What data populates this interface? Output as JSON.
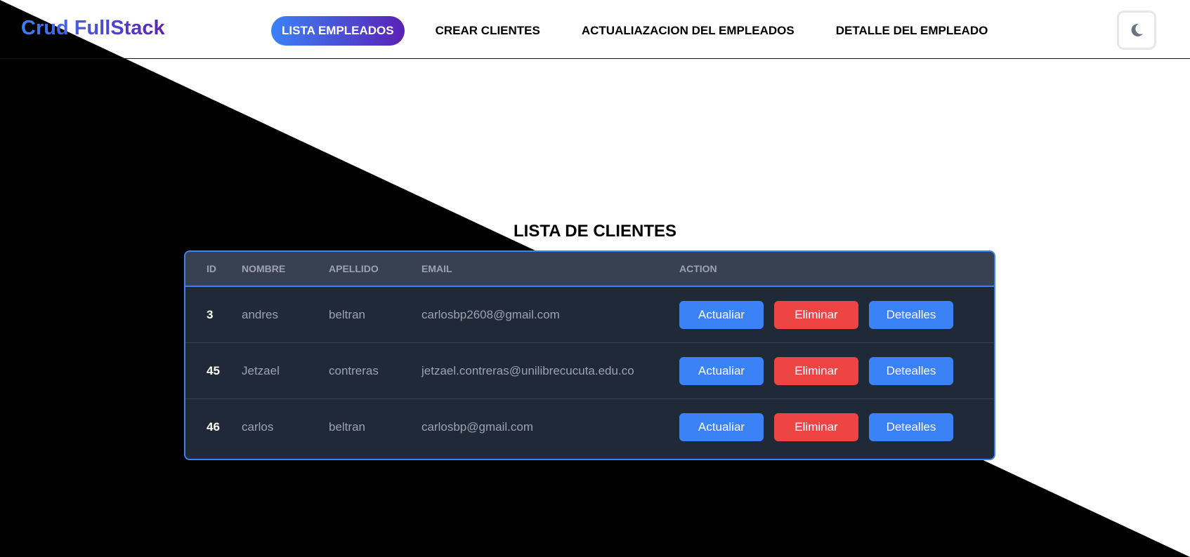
{
  "navbar": {
    "brand": "Crud FullStack",
    "links": [
      {
        "label": "LISTA EMPLEADOS",
        "active": true
      },
      {
        "label": "CREAR CLIENTES",
        "active": false
      },
      {
        "label": "ACTUALIAZACION DEL EMPLEADOS",
        "active": false
      },
      {
        "label": "DETALLE DEL EMPLEADO",
        "active": false
      }
    ],
    "theme_toggle_icon": "moon-icon"
  },
  "main": {
    "title": "LISTA DE CLIENTES",
    "table": {
      "headers": [
        "ID",
        "NOMBRE",
        "APELLIDO",
        "EMAIL",
        "ACTION"
      ],
      "rows": [
        {
          "id": "3",
          "nombre": "andres",
          "apellido": "beltran",
          "email": "carlosbp2608@gmail.com"
        },
        {
          "id": "45",
          "nombre": "Jetzael",
          "apellido": "contreras",
          "email": "jetzael.contreras@unilibrecucuta.edu.co"
        },
        {
          "id": "46",
          "nombre": "carlos",
          "apellido": "beltran",
          "email": "carlosbp@gmail.com"
        }
      ],
      "actions": {
        "update": "Actualiar",
        "delete": "Eliminar",
        "details": "Detealles"
      }
    }
  },
  "colors": {
    "accent_blue": "#3b82f6",
    "accent_purple": "#5b21b6",
    "danger": "#ef4444",
    "dark_table": "#1f2937"
  }
}
